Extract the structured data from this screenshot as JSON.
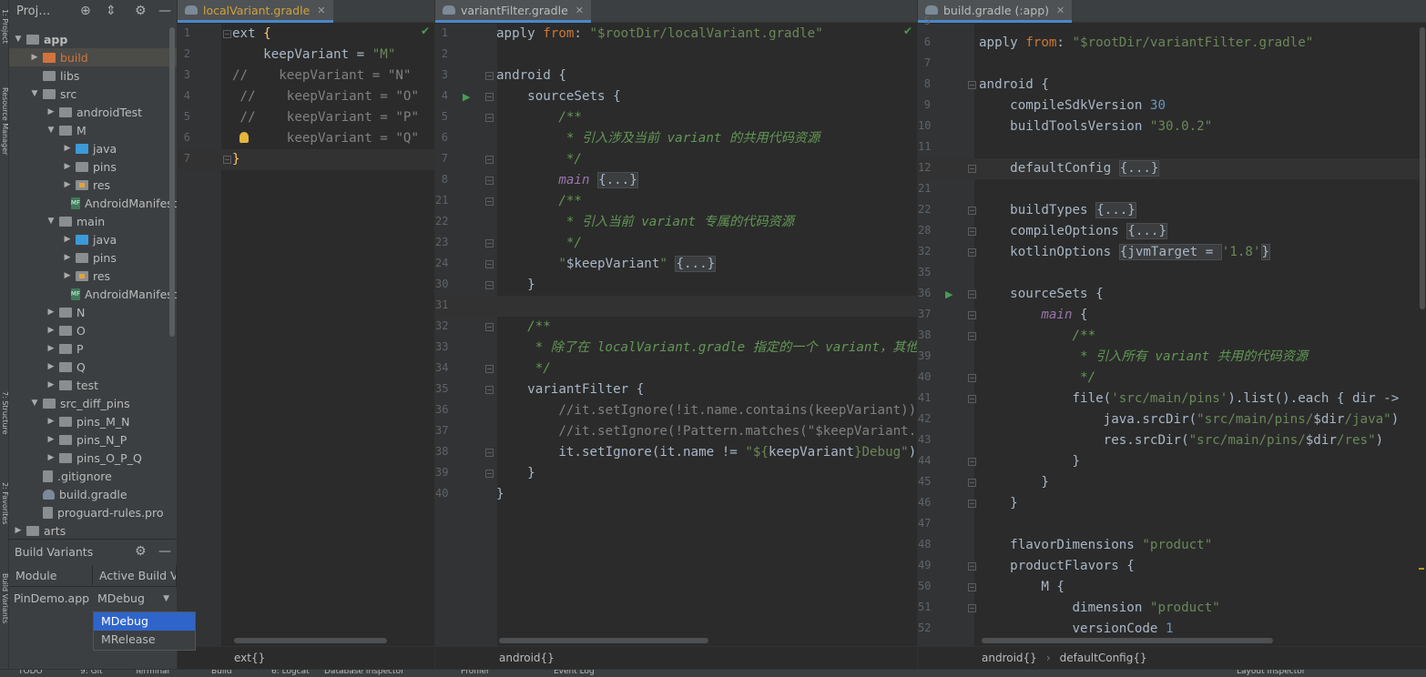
{
  "project": {
    "title": "Proj…"
  },
  "side_labels": {
    "project": "1: Project",
    "resource": "Resource Manager",
    "structure": "7: Structure",
    "favorites": "2: Favorites",
    "variants": "Build Variants"
  },
  "tree": [
    {
      "label": "app",
      "depth": 1,
      "arrow": "▼",
      "icon": "gray",
      "bold": true
    },
    {
      "label": "build",
      "depth": 2,
      "arrow": "▶",
      "icon": "orange",
      "color": "#d3733d",
      "selected": true
    },
    {
      "label": "libs",
      "depth": 2,
      "arrow": "",
      "icon": "gray"
    },
    {
      "label": "src",
      "depth": 2,
      "arrow": "▼",
      "icon": "gray"
    },
    {
      "label": "androidTest",
      "depth": 3,
      "arrow": "▶",
      "icon": "gray"
    },
    {
      "label": "M",
      "depth": 3,
      "arrow": "▼",
      "icon": "gray"
    },
    {
      "label": "java",
      "depth": 4,
      "arrow": "▶",
      "icon": "blue"
    },
    {
      "label": "pins",
      "depth": 4,
      "arrow": "▶",
      "icon": "gray"
    },
    {
      "label": "res",
      "depth": 4,
      "arrow": "▶",
      "icon": "res"
    },
    {
      "label": "AndroidManifest.xml",
      "depth": 4,
      "arrow": "",
      "icon": "mf"
    },
    {
      "label": "main",
      "depth": 3,
      "arrow": "▼",
      "icon": "gray"
    },
    {
      "label": "java",
      "depth": 4,
      "arrow": "▶",
      "icon": "blue"
    },
    {
      "label": "pins",
      "depth": 4,
      "arrow": "▶",
      "icon": "gray"
    },
    {
      "label": "res",
      "depth": 4,
      "arrow": "▶",
      "icon": "res"
    },
    {
      "label": "AndroidManifest.xml",
      "depth": 4,
      "arrow": "",
      "icon": "mf"
    },
    {
      "label": "N",
      "depth": 3,
      "arrow": "▶",
      "icon": "gray"
    },
    {
      "label": "O",
      "depth": 3,
      "arrow": "▶",
      "icon": "gray"
    },
    {
      "label": "P",
      "depth": 3,
      "arrow": "▶",
      "icon": "gray"
    },
    {
      "label": "Q",
      "depth": 3,
      "arrow": "▶",
      "icon": "gray"
    },
    {
      "label": "test",
      "depth": 3,
      "arrow": "▶",
      "icon": "gray"
    },
    {
      "label": "src_diff_pins",
      "depth": 2,
      "arrow": "▼",
      "icon": "gray"
    },
    {
      "label": "pins_M_N",
      "depth": 3,
      "arrow": "▶",
      "icon": "gray"
    },
    {
      "label": "pins_N_P",
      "depth": 3,
      "arrow": "▶",
      "icon": "gray"
    },
    {
      "label": "pins_O_P_Q",
      "depth": 3,
      "arrow": "▶",
      "icon": "gray"
    },
    {
      "label": ".gitignore",
      "depth": 2,
      "arrow": "",
      "icon": "file"
    },
    {
      "label": "build.gradle",
      "depth": 2,
      "arrow": "",
      "icon": "gradle"
    },
    {
      "label": "proguard-rules.pro",
      "depth": 2,
      "arrow": "",
      "icon": "file"
    },
    {
      "label": "arts",
      "depth": 1,
      "arrow": "▶",
      "icon": "gray"
    }
  ],
  "build_variants": {
    "title": "Build Variants",
    "col_module": "Module",
    "col_active": "Active Build Variant",
    "module": "PinDemo.app",
    "active": "MDebug",
    "options": [
      "MDebug",
      "MRelease"
    ],
    "selected_option": "MDebug"
  },
  "editors": [
    {
      "tab": "localVariant.gradle",
      "tab_color": "#d0a040",
      "breadcrumb": [
        "ext{}"
      ],
      "lines": [
        {
          "n": "1",
          "t": [
            [
              "ext ",
              ""
            ],
            [
              "{",
              "t-y"
            ]
          ]
        },
        {
          "n": "2",
          "t": [
            [
              "    keepVariant = ",
              ""
            ],
            [
              "\"M\"",
              "t-s"
            ]
          ]
        },
        {
          "n": "3",
          "t": [
            [
              "//    keepVariant = \"N\"",
              "t-lc"
            ]
          ]
        },
        {
          "n": "4",
          "t": [
            [
              " //    keepVariant = \"O\"",
              "t-lc"
            ]
          ]
        },
        {
          "n": "5",
          "t": [
            [
              " //    keepVariant = \"P\"",
              "t-lc"
            ]
          ]
        },
        {
          "n": "6",
          "t": [
            [
              " /     keepVariant = \"Q\"",
              "t-lc"
            ]
          ]
        },
        {
          "n": "7",
          "t": [
            [
              "}",
              "t-y"
            ]
          ]
        }
      ]
    },
    {
      "tab": "variantFilter.gradle",
      "breadcrumb": [
        "android{}"
      ],
      "lines": [
        {
          "n": "1",
          "t": [
            [
              "apply ",
              ""
            ],
            [
              "from",
              "t-k"
            ],
            [
              ": ",
              ""
            ],
            [
              "\"$rootDir/",
              "t-s"
            ],
            [
              "localVariant.gradle",
              "t-s"
            ],
            [
              "\"",
              "t-s"
            ]
          ]
        },
        {
          "n": "2",
          "t": []
        },
        {
          "n": "3",
          "t": [
            [
              "android {",
              ""
            ]
          ]
        },
        {
          "n": "4",
          "t": [
            [
              "    sourceSets {",
              ""
            ]
          ]
        },
        {
          "n": "5",
          "t": [
            [
              "        /**",
              "t-c"
            ]
          ]
        },
        {
          "n": "6",
          "t": [
            [
              "         * 引入涉及当前 variant 的共用代码资源",
              "t-c"
            ]
          ]
        },
        {
          "n": "7",
          "t": [
            [
              "         */",
              "t-c"
            ]
          ]
        },
        {
          "n": "8",
          "t": [
            [
              "        ",
              ""
            ],
            [
              "main",
              "t-p"
            ],
            [
              " ",
              ""
            ],
            [
              "{...}",
              "t-ph"
            ]
          ]
        },
        {
          "n": "21",
          "t": [
            [
              "        /**",
              "t-c"
            ]
          ]
        },
        {
          "n": "22",
          "t": [
            [
              "         * 引入当前 variant 专属的代码资源",
              "t-c"
            ]
          ]
        },
        {
          "n": "23",
          "t": [
            [
              "         */",
              "t-c"
            ]
          ]
        },
        {
          "n": "24",
          "t": [
            [
              "        \"",
              "t-s"
            ],
            [
              "$keepVariant",
              ""
            ],
            [
              "\"",
              "t-s"
            ],
            [
              " ",
              ""
            ],
            [
              "{...}",
              "t-ph"
            ]
          ]
        },
        {
          "n": "30",
          "t": [
            [
              "    }",
              ""
            ]
          ]
        },
        {
          "n": "31",
          "t": []
        },
        {
          "n": "32",
          "t": [
            [
              "    /**",
              "t-c"
            ]
          ]
        },
        {
          "n": "33",
          "t": [
            [
              "     * 除了在 localVariant.gradle 指定的一个 variant，其他的都屏蔽掉",
              "t-c"
            ]
          ]
        },
        {
          "n": "34",
          "t": [
            [
              "     */",
              "t-c"
            ]
          ]
        },
        {
          "n": "35",
          "t": [
            [
              "    variantFilter {",
              ""
            ]
          ]
        },
        {
          "n": "36",
          "t": [
            [
              "        //it.setIgnore(!it.name.contains(keepVariant))",
              "t-lc"
            ]
          ]
        },
        {
          "n": "37",
          "t": [
            [
              "        //it.setIgnore(!Pattern.matches(\"$keepVariant.*\", it.name))",
              "t-lc"
            ]
          ]
        },
        {
          "n": "38",
          "t": [
            [
              "        it.setIgnore(it.name != ",
              ""
            ],
            [
              "\"${",
              "t-s"
            ],
            [
              "keepVariant",
              ""
            ],
            [
              "}Debug\"",
              "t-s"
            ],
            [
              ")",
              ""
            ]
          ]
        },
        {
          "n": "39",
          "t": [
            [
              "    }",
              ""
            ]
          ]
        },
        {
          "n": "40",
          "t": [
            [
              "}",
              ""
            ]
          ]
        }
      ]
    },
    {
      "tab": "build.gradle (:app)",
      "breadcrumb": [
        "android{}",
        "defaultConfig{}"
      ],
      "lines": [
        {
          "n": "5",
          "t": []
        },
        {
          "n": "6",
          "t": [
            [
              "apply ",
              ""
            ],
            [
              "from",
              "t-k"
            ],
            [
              ": ",
              ""
            ],
            [
              "\"$rootDir/variantFilter.gradle\"",
              "t-s"
            ]
          ]
        },
        {
          "n": "7",
          "t": []
        },
        {
          "n": "8",
          "t": [
            [
              "android {",
              ""
            ]
          ]
        },
        {
          "n": "9",
          "t": [
            [
              "    compileSdkVersion ",
              ""
            ],
            [
              "30",
              "t-n"
            ]
          ]
        },
        {
          "n": "10",
          "t": [
            [
              "    buildToolsVersion ",
              ""
            ],
            [
              "\"30.0.2\"",
              "t-s"
            ]
          ]
        },
        {
          "n": "11",
          "t": []
        },
        {
          "n": "12",
          "t": [
            [
              "    defaultConfig ",
              ""
            ],
            [
              "{...}",
              "t-ph"
            ]
          ]
        },
        {
          "n": "21",
          "t": []
        },
        {
          "n": "22",
          "t": [
            [
              "    buildTypes ",
              ""
            ],
            [
              "{...}",
              "t-ph"
            ]
          ]
        },
        {
          "n": "28",
          "t": [
            [
              "    compileOptions ",
              ""
            ],
            [
              "{...}",
              "t-ph"
            ]
          ]
        },
        {
          "n": "32",
          "t": [
            [
              "    kotlinOptions ",
              ""
            ],
            [
              "{jvmTarget = ",
              "t-ph"
            ],
            [
              "'1.8'",
              "t-s"
            ],
            [
              "}",
              "t-ph"
            ]
          ]
        },
        {
          "n": "35",
          "t": []
        },
        {
          "n": "36",
          "t": [
            [
              "    sourceSets {",
              ""
            ]
          ]
        },
        {
          "n": "37",
          "t": [
            [
              "        ",
              ""
            ],
            [
              "main",
              "t-p"
            ],
            [
              " {",
              ""
            ]
          ]
        },
        {
          "n": "38",
          "t": [
            [
              "            /**",
              "t-c"
            ]
          ]
        },
        {
          "n": "39",
          "t": [
            [
              "             * 引入所有 variant 共用的代码资源",
              "t-c"
            ]
          ]
        },
        {
          "n": "40",
          "t": [
            [
              "             */",
              "t-c"
            ]
          ]
        },
        {
          "n": "41",
          "t": [
            [
              "            file(",
              ""
            ],
            [
              "'src/main/pins'",
              "t-s"
            ],
            [
              ").list().each { dir ->",
              ""
            ]
          ]
        },
        {
          "n": "42",
          "t": [
            [
              "                java.srcDir(",
              ""
            ],
            [
              "\"src/main/pins/",
              "t-s"
            ],
            [
              "$dir",
              ""
            ],
            [
              "/java\"",
              "t-s"
            ],
            [
              ")",
              ""
            ]
          ]
        },
        {
          "n": "43",
          "t": [
            [
              "                res.srcDir(",
              ""
            ],
            [
              "\"src/main/pins/",
              "t-s"
            ],
            [
              "$dir",
              ""
            ],
            [
              "/res\"",
              "t-s"
            ],
            [
              ")",
              ""
            ]
          ]
        },
        {
          "n": "44",
          "t": [
            [
              "            }",
              ""
            ]
          ]
        },
        {
          "n": "45",
          "t": [
            [
              "        }",
              ""
            ]
          ]
        },
        {
          "n": "46",
          "t": [
            [
              "    }",
              ""
            ]
          ]
        },
        {
          "n": "47",
          "t": []
        },
        {
          "n": "48",
          "t": [
            [
              "    flavorDimensions ",
              ""
            ],
            [
              "\"product\"",
              "t-s"
            ]
          ]
        },
        {
          "n": "49",
          "t": [
            [
              "    productFlavors {",
              ""
            ]
          ]
        },
        {
          "n": "50",
          "t": [
            [
              "        M {",
              ""
            ]
          ]
        },
        {
          "n": "51",
          "t": [
            [
              "            dimension ",
              ""
            ],
            [
              "\"product\"",
              "t-s"
            ]
          ]
        },
        {
          "n": "52",
          "t": [
            [
              "            versionCode ",
              ""
            ],
            [
              "1",
              "t-n"
            ]
          ]
        }
      ]
    }
  ],
  "status_bar": {
    "items": [
      "TODO",
      "9: Git",
      "Terminal",
      "Build",
      "6: Logcat",
      "Database Inspector",
      "Profiler",
      "Event Log",
      "Layout Inspector"
    ]
  }
}
